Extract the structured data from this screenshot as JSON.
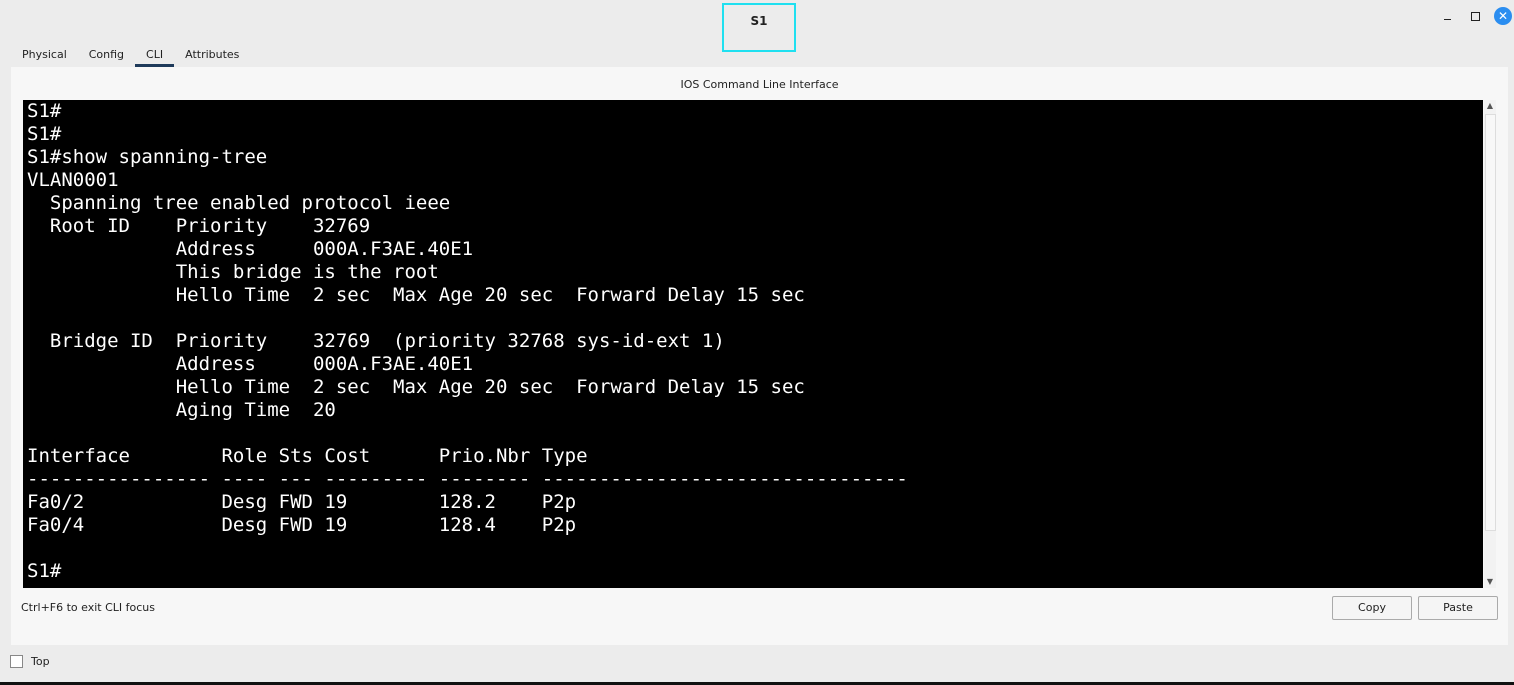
{
  "window": {
    "title": "S1",
    "minimize_glyph": "",
    "maximize_glyph": "",
    "close_glyph": "✕"
  },
  "tabs": [
    {
      "label": "Physical"
    },
    {
      "label": "Config"
    },
    {
      "label": "CLI",
      "active": true
    },
    {
      "label": "Attributes"
    }
  ],
  "cli": {
    "title": "IOS Command Line Interface",
    "output": "S1#\nS1#\nS1#show spanning-tree\nVLAN0001\n  Spanning tree enabled protocol ieee\n  Root ID    Priority    32769\n             Address     000A.F3AE.40E1\n             This bridge is the root\n             Hello Time  2 sec  Max Age 20 sec  Forward Delay 15 sec\n\n  Bridge ID  Priority    32769  (priority 32768 sys-id-ext 1)\n             Address     000A.F3AE.40E1\n             Hello Time  2 sec  Max Age 20 sec  Forward Delay 15 sec\n             Aging Time  20\n\nInterface        Role Sts Cost      Prio.Nbr Type\n---------------- ---- --- --------- -------- --------------------------------\nFa0/2            Desg FWD 19        128.2    P2p\nFa0/4            Desg FWD 19        128.4    P2p\n\nS1#",
    "hint": "Ctrl+F6 to exit CLI focus",
    "copy_label": "Copy",
    "paste_label": "Paste"
  },
  "footer": {
    "top_label": "Top",
    "top_checked": false
  }
}
